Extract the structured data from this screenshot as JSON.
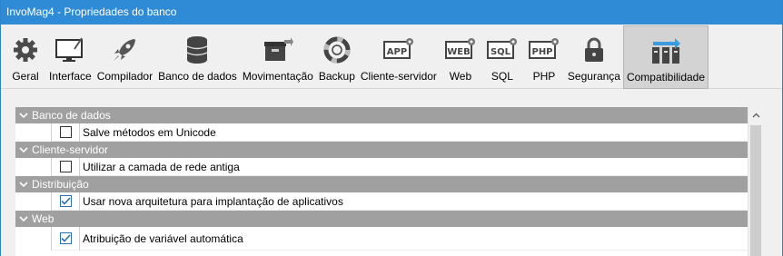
{
  "window": {
    "title": "InvoMag4 - Propriedades do banco"
  },
  "toolbar": {
    "items": [
      {
        "label": "Geral",
        "icon": "gear-icon"
      },
      {
        "label": "Interface",
        "icon": "monitor-icon"
      },
      {
        "label": "Compilador",
        "icon": "rocket-icon"
      },
      {
        "label": "Banco de dados",
        "icon": "database-icon"
      },
      {
        "label": "Movimentação",
        "icon": "box-arrow-icon"
      },
      {
        "label": "Backup",
        "icon": "lifebuoy-icon"
      },
      {
        "label": "Cliente-servidor",
        "icon": "app-icon",
        "badge": "APP"
      },
      {
        "label": "Web",
        "icon": "web-icon",
        "badge": "WEB"
      },
      {
        "label": "SQL",
        "icon": "sql-icon",
        "badge": "SQL"
      },
      {
        "label": "PHP",
        "icon": "php-icon",
        "badge": "PHP"
      },
      {
        "label": "Segurança",
        "icon": "lock-icon"
      },
      {
        "label": "Compatibilidade",
        "icon": "compatibility-icon"
      }
    ],
    "active_index": 11
  },
  "categories": [
    {
      "label": "Banco de dados",
      "rows": [
        {
          "label": "Salve métodos em Unicode",
          "checked": false
        }
      ]
    },
    {
      "label": "Cliente-servidor",
      "rows": [
        {
          "label": "Utilizar a camada de rede antiga",
          "checked": false
        }
      ]
    },
    {
      "label": "Distribuição",
      "rows": [
        {
          "label": "Usar nova arquitetura para implantação de aplicativos",
          "checked": true
        }
      ]
    },
    {
      "label": "Web",
      "rows": [
        {
          "label": "Atribuição de variável automática",
          "checked": true
        }
      ]
    }
  ],
  "colors": {
    "titlebar": "#2f8bd6",
    "category": "#a0a0a0",
    "active_tab": "#d3d3d3",
    "check": "#2b6fb0"
  }
}
